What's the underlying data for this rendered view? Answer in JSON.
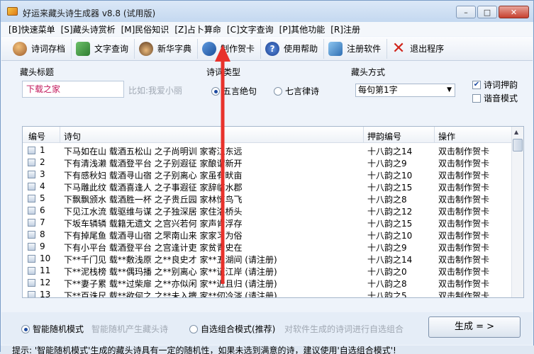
{
  "window": {
    "title": "好运来藏头诗生成器 v8.8 (试用版)",
    "buttons": {
      "minimize": "–",
      "maximize": "□",
      "close": "✕"
    }
  },
  "menu": [
    "[B]快速菜单",
    "[S]藏头诗赏析",
    "[M]民俗知识",
    "[Z]占卜算命",
    "[C]文字查询",
    "[P]其他功能",
    "[R]注册"
  ],
  "toolbar": [
    {
      "label": "诗词存档",
      "icon": "people-icon"
    },
    {
      "label": "文字查询",
      "icon": "refresh-icon"
    },
    {
      "label": "新华字典",
      "icon": "scholar-icon"
    },
    {
      "label": "制作贺卡",
      "icon": "redo-icon"
    },
    {
      "label": "使用帮助",
      "icon": "help-icon"
    },
    {
      "label": "注册软件",
      "icon": "monitor-icon"
    },
    {
      "label": "退出程序",
      "icon": "exit-x-icon"
    }
  ],
  "form": {
    "title_label": "藏头标题",
    "title_value": "下载之家",
    "title_hint": "比如:我爱小丽",
    "poem_type_label": "诗词类型",
    "poem_types": [
      "五言绝句",
      "七言律诗"
    ],
    "poem_type_selected": "五言绝句",
    "mode_label": "藏头方式",
    "mode_value": "每句第1字",
    "rhyme_label": "诗词押韵",
    "rhyme_checked": true,
    "harmonic_label": "谐音模式",
    "harmonic_checked": false
  },
  "table": {
    "headers": [
      "编号",
      "诗句",
      "押韵编号",
      "操作"
    ],
    "rows": [
      {
        "id": "1",
        "poem": "下马如在山  载酒五松山  之子尚明训  家寄江东远",
        "rhyme": "十八韵之14",
        "op": "双击制作贺卡"
      },
      {
        "id": "2",
        "poem": "下有清浅濑  载酒登平台  之子别遐征  家酿谓新开",
        "rhyme": "十八韵之9",
        "op": "双击制作贺卡"
      },
      {
        "id": "3",
        "poem": "下有感秋妇  载酒寻山宿  之子别离心  家虽有畎亩",
        "rhyme": "十八韵之10",
        "op": "双击制作贺卡"
      },
      {
        "id": "4",
        "poem": "下马雕此纹  载酒喜逢人  之子事遐征  家辞临水郡",
        "rhyme": "十八韵之15",
        "op": "双击制作贺卡"
      },
      {
        "id": "5",
        "poem": "下飘飘颁水  载酒胜一杯  之子贵丘园  家林惊鸟飞",
        "rhyme": "十八韵之8",
        "op": "双击制作贺卡"
      },
      {
        "id": "6",
        "poem": "下见江水流  载驱维与谋  之子独深居  家住洛桥头",
        "rhyme": "十八韵之12",
        "op": "双击制作贺卡"
      },
      {
        "id": "7",
        "poem": "下坂车辚辚  载籍无遗文  之宫兴若何  家声肯浮存",
        "rhyme": "十八韵之15",
        "op": "双击制作贺卡"
      },
      {
        "id": "8",
        "poem": "下有掉尾鱼  载酒寻山宿  之罘南山来  家家习为俗",
        "rhyme": "十八韵之10",
        "op": "双击制作贺卡"
      },
      {
        "id": "9",
        "poem": "下有小平台  载酒登平台  之宫逢计吏  家贫青史在",
        "rhyme": "十八韵之9",
        "op": "双击制作贺卡"
      },
      {
        "id": "10",
        "poem": "下**千门见  载**敷浅原  之**良史才  家**五湖间   (请注册)",
        "rhyme": "十八韵之14",
        "op": "双击制作贺卡"
      },
      {
        "id": "11",
        "poem": "下**泥栈榜  载**偶玛播  之**别离心  家**证江岸   (请注册)",
        "rhyme": "十八韵之0",
        "op": "双击制作贺卡"
      },
      {
        "id": "12",
        "poem": "下**妻子累  载**过柴扉  之**亦似闲  家**近且归   (请注册)",
        "rhyme": "十八韵之8",
        "op": "双击制作贺卡"
      },
      {
        "id": "13",
        "poem": "下**百诛尺  载**欲何之  之**未入擅  家**仞冷涔   (请注册)",
        "rhyme": "十八韵之5",
        "op": "双击制作贺卡"
      }
    ]
  },
  "bottom": {
    "mode1_label": "智能随机模式",
    "mode1_desc": "智能随机产生藏头诗",
    "mode2_label": "自选组合模式(推荐)",
    "mode2_desc": "对软件生成的诗词进行自选组合",
    "selected": "智能随机模式",
    "generate_label": "生成 = >"
  },
  "status": "提示: '智能随机模式'生成的藏头诗具有一定的随机性，如果未选到满意的诗，建议使用'自选组合模式'!",
  "colors": {
    "title_value": "#c2185b",
    "annotation_arrow": "#e8322c"
  }
}
